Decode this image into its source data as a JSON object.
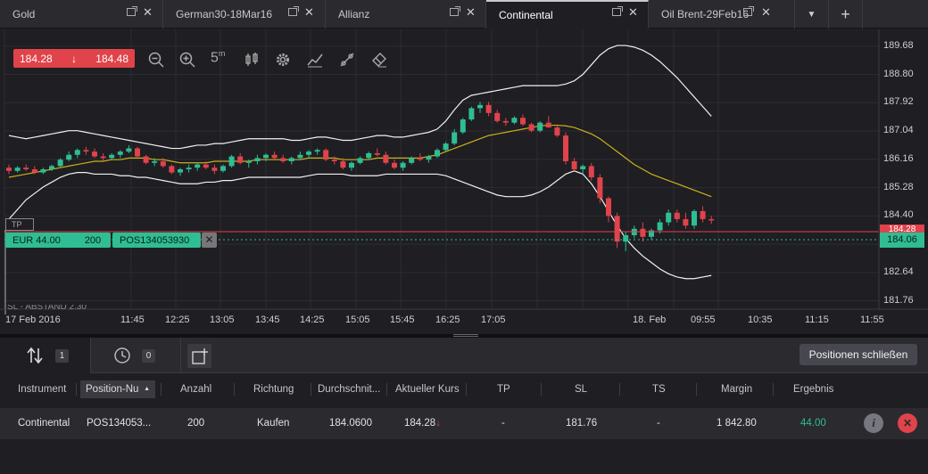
{
  "tabs": [
    {
      "label": "Gold",
      "active": false
    },
    {
      "label": "German30-18Mar16",
      "active": false
    },
    {
      "label": "Allianz",
      "active": false
    },
    {
      "label": "Continental",
      "active": true
    },
    {
      "label": "Oil Brent-29Feb16",
      "active": false
    }
  ],
  "tab_controls": {
    "dropdown": "▼",
    "add": "+",
    "close": "✕"
  },
  "chart": {
    "bid": "184.28",
    "ask": "184.48",
    "arrow": "↓",
    "position": {
      "currency": "EUR 44.00",
      "quantity": "200",
      "id": "POS134053930",
      "close": "✕"
    },
    "tp_label": "TP",
    "sl_label": "SL - ABSTAND 2.30",
    "current_price_label": "184.06",
    "red_line_label": "184.28",
    "y_ticks": [
      "189.68",
      "188.80",
      "187.92",
      "187.04",
      "186.16",
      "185.28",
      "184.40",
      "183.52",
      "182.64",
      "181.76"
    ],
    "x_ticks": [
      "17 Feb 2016",
      "11:45",
      "12:25",
      "13:05",
      "13:45",
      "14:25",
      "15:05",
      "15:45",
      "16:25",
      "17:05",
      "18. Feb",
      "09:55",
      "10:35",
      "11:15",
      "11:55"
    ],
    "toolbar": [
      "zoom-out-icon",
      "zoom-in-icon",
      "timeframe-icon",
      "candle-icon",
      "settings-icon",
      "indicator-icon",
      "drawing-icon",
      "eraser-icon"
    ],
    "timeframe": "5",
    "timeframe_unit": "m"
  },
  "chart_data": {
    "type": "candlestick",
    "ylim": [
      181.5,
      190.2
    ],
    "colors": {
      "up": "#2fbd94",
      "down": "#e0434a",
      "bands": "#f2f2f2",
      "ma": "#c9b21a"
    },
    "candles": [
      [
        0,
        185.9,
        186.0,
        185.7,
        185.8
      ],
      [
        1,
        185.8,
        185.95,
        185.75,
        185.9
      ],
      [
        2,
        185.9,
        186.0,
        185.8,
        185.85
      ],
      [
        3,
        185.85,
        185.95,
        185.7,
        185.75
      ],
      [
        4,
        185.75,
        185.9,
        185.7,
        185.85
      ],
      [
        5,
        185.85,
        186.0,
        185.8,
        185.95
      ],
      [
        6,
        185.95,
        186.2,
        185.9,
        186.15
      ],
      [
        7,
        186.15,
        186.4,
        186.1,
        186.3
      ],
      [
        8,
        186.3,
        186.5,
        186.2,
        186.45
      ],
      [
        9,
        186.45,
        186.55,
        186.3,
        186.4
      ],
      [
        10,
        186.4,
        186.5,
        186.2,
        186.25
      ],
      [
        11,
        186.25,
        186.35,
        186.1,
        186.2
      ],
      [
        12,
        186.2,
        186.35,
        186.15,
        186.3
      ],
      [
        13,
        186.3,
        186.45,
        186.2,
        186.4
      ],
      [
        14,
        186.4,
        186.6,
        186.35,
        186.5
      ],
      [
        15,
        186.5,
        186.55,
        186.2,
        186.25
      ],
      [
        16,
        186.25,
        186.3,
        186.0,
        186.05
      ],
      [
        17,
        186.05,
        186.2,
        185.95,
        186.1
      ],
      [
        18,
        186.1,
        186.2,
        185.9,
        185.95
      ],
      [
        19,
        185.95,
        186.0,
        185.7,
        185.75
      ],
      [
        20,
        185.75,
        185.9,
        185.65,
        185.85
      ],
      [
        21,
        185.85,
        186.0,
        185.75,
        185.9
      ],
      [
        22,
        185.9,
        186.05,
        185.8,
        186.0
      ],
      [
        23,
        186.0,
        186.1,
        185.85,
        185.9
      ],
      [
        24,
        185.9,
        186.0,
        185.7,
        185.8
      ],
      [
        25,
        185.8,
        186.0,
        185.75,
        185.95
      ],
      [
        26,
        185.95,
        186.3,
        185.9,
        186.25
      ],
      [
        27,
        186.25,
        186.35,
        186.0,
        186.05
      ],
      [
        28,
        186.05,
        186.15,
        185.9,
        186.1
      ],
      [
        29,
        186.1,
        186.3,
        186.0,
        186.2
      ],
      [
        30,
        186.2,
        186.35,
        186.1,
        186.3
      ],
      [
        31,
        186.3,
        186.4,
        186.15,
        186.2
      ],
      [
        32,
        186.2,
        186.3,
        186.05,
        186.1
      ],
      [
        33,
        186.1,
        186.25,
        186.0,
        186.2
      ],
      [
        34,
        186.2,
        186.4,
        186.15,
        186.3
      ],
      [
        35,
        186.3,
        186.45,
        186.2,
        186.4
      ],
      [
        36,
        186.4,
        186.5,
        186.3,
        186.45
      ],
      [
        37,
        186.45,
        186.5,
        186.1,
        186.15
      ],
      [
        38,
        186.15,
        186.25,
        186.0,
        186.1
      ],
      [
        39,
        186.1,
        186.2,
        185.85,
        185.9
      ],
      [
        40,
        185.9,
        186.1,
        185.8,
        186.05
      ],
      [
        41,
        186.05,
        186.25,
        186.0,
        186.2
      ],
      [
        42,
        186.2,
        186.4,
        186.15,
        186.35
      ],
      [
        43,
        186.35,
        186.5,
        186.25,
        186.3
      ],
      [
        44,
        186.3,
        186.4,
        186.0,
        186.05
      ],
      [
        45,
        186.05,
        186.15,
        185.85,
        185.9
      ],
      [
        46,
        185.9,
        186.1,
        185.8,
        186.05
      ],
      [
        47,
        186.05,
        186.25,
        186.0,
        186.2
      ],
      [
        48,
        186.2,
        186.35,
        186.1,
        186.15
      ],
      [
        49,
        186.15,
        186.3,
        186.05,
        186.25
      ],
      [
        50,
        186.25,
        186.5,
        186.2,
        186.45
      ],
      [
        51,
        186.45,
        186.7,
        186.4,
        186.65
      ],
      [
        52,
        186.65,
        187.1,
        186.6,
        187.0
      ],
      [
        53,
        187.0,
        187.45,
        186.95,
        187.4
      ],
      [
        54,
        187.4,
        187.8,
        187.35,
        187.75
      ],
      [
        55,
        187.75,
        187.95,
        187.6,
        187.85
      ],
      [
        56,
        187.85,
        187.95,
        187.5,
        187.6
      ],
      [
        57,
        187.6,
        187.7,
        187.3,
        187.35
      ],
      [
        58,
        187.35,
        187.45,
        187.2,
        187.3
      ],
      [
        59,
        187.3,
        187.5,
        187.25,
        187.45
      ],
      [
        60,
        187.45,
        187.55,
        187.2,
        187.25
      ],
      [
        61,
        187.25,
        187.3,
        187.0,
        187.05
      ],
      [
        62,
        187.05,
        187.35,
        187.0,
        187.3
      ],
      [
        63,
        187.3,
        187.5,
        187.2,
        187.15
      ],
      [
        64,
        187.15,
        187.2,
        186.85,
        186.9
      ],
      [
        65,
        186.9,
        187.0,
        186.0,
        186.1
      ],
      [
        66,
        186.1,
        186.2,
        185.8,
        185.85
      ],
      [
        67,
        185.85,
        186.0,
        185.7,
        185.95
      ],
      [
        68,
        185.95,
        186.05,
        185.5,
        185.6
      ],
      [
        69,
        185.6,
        185.7,
        184.8,
        184.95
      ],
      [
        70,
        184.95,
        185.0,
        184.2,
        184.4
      ],
      [
        71,
        184.4,
        184.5,
        183.4,
        183.6
      ],
      [
        72,
        183.6,
        183.9,
        183.3,
        183.8
      ],
      [
        73,
        183.8,
        184.1,
        183.7,
        184.0
      ],
      [
        74,
        184.0,
        184.2,
        183.6,
        183.75
      ],
      [
        75,
        183.75,
        184.0,
        183.65,
        183.95
      ],
      [
        76,
        183.95,
        184.3,
        183.85,
        184.2
      ],
      [
        77,
        184.2,
        184.6,
        184.1,
        184.5
      ],
      [
        78,
        184.5,
        184.6,
        184.2,
        184.3
      ],
      [
        79,
        184.3,
        184.5,
        184.0,
        184.1
      ],
      [
        80,
        184.1,
        184.6,
        184.0,
        184.55
      ],
      [
        81,
        184.55,
        184.7,
        184.2,
        184.3
      ],
      [
        82,
        184.3,
        184.4,
        184.15,
        184.28
      ]
    ],
    "band_upper": [
      186.9,
      186.85,
      186.8,
      186.85,
      186.9,
      186.95,
      187.0,
      187.05,
      187.05,
      187.0,
      186.95,
      186.9,
      186.85,
      186.8,
      186.75,
      186.7,
      186.65,
      186.6,
      186.55,
      186.5,
      186.5,
      186.55,
      186.6,
      186.6,
      186.65,
      186.65,
      186.7,
      186.75,
      186.8,
      186.8,
      186.8,
      186.8,
      186.8,
      186.75,
      186.75,
      186.8,
      186.85,
      186.85,
      186.8,
      186.75,
      186.75,
      186.8,
      186.85,
      186.9,
      186.9,
      186.85,
      186.85,
      186.9,
      186.95,
      187.0,
      187.1,
      187.35,
      187.7,
      188.0,
      188.15,
      188.2,
      188.25,
      188.3,
      188.35,
      188.4,
      188.45,
      188.45,
      188.45,
      188.45,
      188.45,
      188.5,
      188.6,
      188.8,
      189.1,
      189.4,
      189.6,
      189.7,
      189.7,
      189.65,
      189.55,
      189.4,
      189.2,
      188.95,
      188.7,
      188.4,
      188.1,
      187.8,
      187.5
    ],
    "band_lower": [
      184.3,
      184.6,
      184.9,
      185.1,
      185.3,
      185.45,
      185.6,
      185.7,
      185.75,
      185.75,
      185.7,
      185.7,
      185.7,
      185.65,
      185.65,
      185.6,
      185.6,
      185.55,
      185.5,
      185.45,
      185.4,
      185.4,
      185.4,
      185.45,
      185.45,
      185.5,
      185.5,
      185.55,
      185.6,
      185.6,
      185.6,
      185.6,
      185.6,
      185.6,
      185.6,
      185.65,
      185.7,
      185.7,
      185.7,
      185.7,
      185.65,
      185.65,
      185.65,
      185.65,
      185.7,
      185.7,
      185.7,
      185.7,
      185.7,
      185.7,
      185.7,
      185.65,
      185.55,
      185.45,
      185.35,
      185.25,
      185.15,
      185.05,
      185.0,
      185.0,
      185.0,
      185.05,
      185.15,
      185.3,
      185.5,
      185.7,
      185.8,
      185.7,
      185.4,
      185.0,
      184.55,
      184.1,
      183.7,
      183.4,
      183.15,
      182.95,
      182.75,
      182.6,
      182.5,
      182.45,
      182.45,
      182.5,
      182.55
    ],
    "ma": [
      185.6,
      185.65,
      185.7,
      185.75,
      185.8,
      185.85,
      185.9,
      185.95,
      186.0,
      186.05,
      186.1,
      186.1,
      186.15,
      186.15,
      186.2,
      186.2,
      186.2,
      186.15,
      186.15,
      186.1,
      186.05,
      186.05,
      186.05,
      186.05,
      186.1,
      186.1,
      186.1,
      186.1,
      186.1,
      186.15,
      186.15,
      186.15,
      186.15,
      186.15,
      186.15,
      186.2,
      186.2,
      186.2,
      186.2,
      186.15,
      186.15,
      186.15,
      186.15,
      186.2,
      186.2,
      186.2,
      186.2,
      186.2,
      186.2,
      186.25,
      186.3,
      186.4,
      186.5,
      186.6,
      186.7,
      186.8,
      186.9,
      186.95,
      187.0,
      187.05,
      187.1,
      187.15,
      187.2,
      187.22,
      187.22,
      187.2,
      187.15,
      187.05,
      186.95,
      186.8,
      186.6,
      186.4,
      186.2,
      186.0,
      185.85,
      185.7,
      185.6,
      185.5,
      185.4,
      185.3,
      185.2,
      185.1,
      185.0
    ]
  },
  "panel": {
    "tab_positions_count": "1",
    "tab_orders_count": "0",
    "close_positions_label": "Positionen schließen",
    "columns": [
      "Instrument",
      "Position-Nu",
      "Anzahl",
      "Richtung",
      "Durchschnit...",
      "Aktueller Kurs",
      "TP",
      "SL",
      "TS",
      "Margin",
      "Ergebnis"
    ],
    "sort_arrow": "▲",
    "row": {
      "instrument": "Continental",
      "position": "POS134053...",
      "quantity": "200",
      "direction": "Kaufen",
      "avg": "184.0600",
      "current": "184.28",
      "current_arrow": "↓",
      "tp": "-",
      "sl": "181.76",
      "ts": "-",
      "margin": "1 842.80",
      "result": "44.00",
      "info_btn": "i",
      "close_btn": "✕"
    }
  }
}
